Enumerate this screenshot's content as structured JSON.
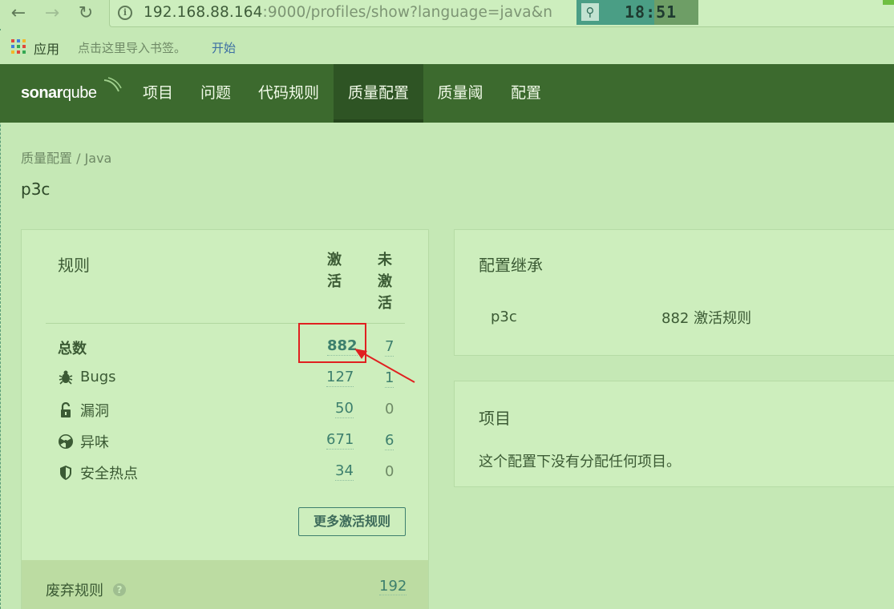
{
  "browser": {
    "url_host": "192.168.88.164",
    "url_rest": ":9000/profiles/show?language=java&n",
    "clock": "18:51",
    "bookmarks": {
      "apps": "应用",
      "hint": "点击这里导入书签。",
      "start": "开始"
    }
  },
  "app": {
    "logo_bold": "sonar",
    "logo_thin": "qube",
    "nav": [
      "项目",
      "问题",
      "代码规则",
      "质量配置",
      "质量阈",
      "配置"
    ],
    "active_nav": "质量配置"
  },
  "page": {
    "breadcrumb": "质量配置 / Java",
    "title": "p3c"
  },
  "rules": {
    "heading": "规则",
    "col_active": [
      "激",
      "活"
    ],
    "col_inactive": [
      "未",
      "激",
      "活"
    ],
    "rows": [
      {
        "label": "总数",
        "icon": "none",
        "active": "882",
        "inactive": "7"
      },
      {
        "label": "Bugs",
        "icon": "bug-icon",
        "active": "127",
        "inactive": "1"
      },
      {
        "label": "漏洞",
        "icon": "lock-icon",
        "active": "50",
        "inactive": "0"
      },
      {
        "label": "异味",
        "icon": "radiation-icon",
        "active": "671",
        "inactive": "6"
      },
      {
        "label": "安全热点",
        "icon": "shield-icon",
        "active": "34",
        "inactive": "0"
      }
    ],
    "more_button": "更多激活规则",
    "deprecated_label": "废弃规则",
    "deprecated_count": "192"
  },
  "inheritance": {
    "title": "配置继承",
    "profile": "p3c",
    "active_rules": "882 激活规则"
  },
  "projects": {
    "title": "项目",
    "empty_text": "这个配置下没有分配任何项目。"
  },
  "colors": {
    "nav_bg": "#3c6a2e",
    "page_bg": "#c5e8b5",
    "link": "#3d7f6d",
    "annotation": "#e02020"
  }
}
